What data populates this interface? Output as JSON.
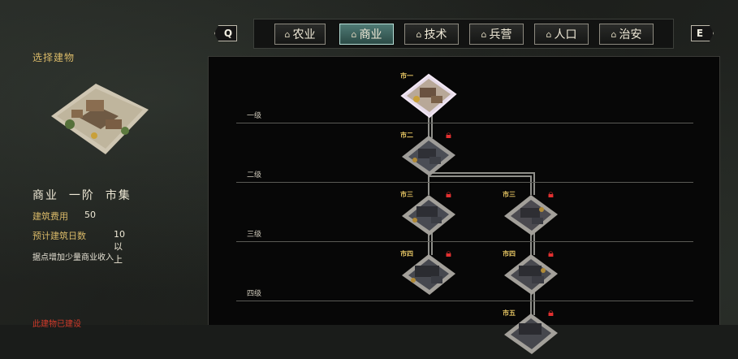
{
  "tabs": {
    "prev_key": "Q",
    "next_key": "E",
    "items": [
      {
        "label": "农业",
        "icon": "building-icon",
        "active": false
      },
      {
        "label": "商业",
        "icon": "building-icon",
        "active": true
      },
      {
        "label": "技术",
        "icon": "building-icon",
        "active": false
      },
      {
        "label": "兵营",
        "icon": "building-icon",
        "active": false
      },
      {
        "label": "人口",
        "icon": "building-icon",
        "active": false
      },
      {
        "label": "治安",
        "icon": "building-icon",
        "active": false
      }
    ]
  },
  "panel": {
    "title": "选择建物",
    "building_name": "商业  一阶  市集",
    "cost_label": "建筑费用",
    "cost_value": "50",
    "days_label": "预计建筑日数",
    "days_value": "10 以上",
    "description": "据点增加少量商业收入",
    "warning": "此建物已建设"
  },
  "tree": {
    "tiers": [
      "一级",
      "二级",
      "三级",
      "四级"
    ],
    "nodes": [
      {
        "label": "市一",
        "locked": false,
        "selected": true
      },
      {
        "label": "市二",
        "locked": true,
        "selected": false
      },
      {
        "label": "市三",
        "locked": true,
        "selected": false
      },
      {
        "label": "市三",
        "locked": true,
        "selected": false
      },
      {
        "label": "市四",
        "locked": true,
        "selected": false
      },
      {
        "label": "市四",
        "locked": true,
        "selected": false
      },
      {
        "label": "市五",
        "locked": true,
        "selected": false
      }
    ]
  },
  "colors": {
    "accent": "#d9b968",
    "active_tab": "#4f7a74",
    "lock": "#e23030",
    "warning": "#d23a2a"
  }
}
